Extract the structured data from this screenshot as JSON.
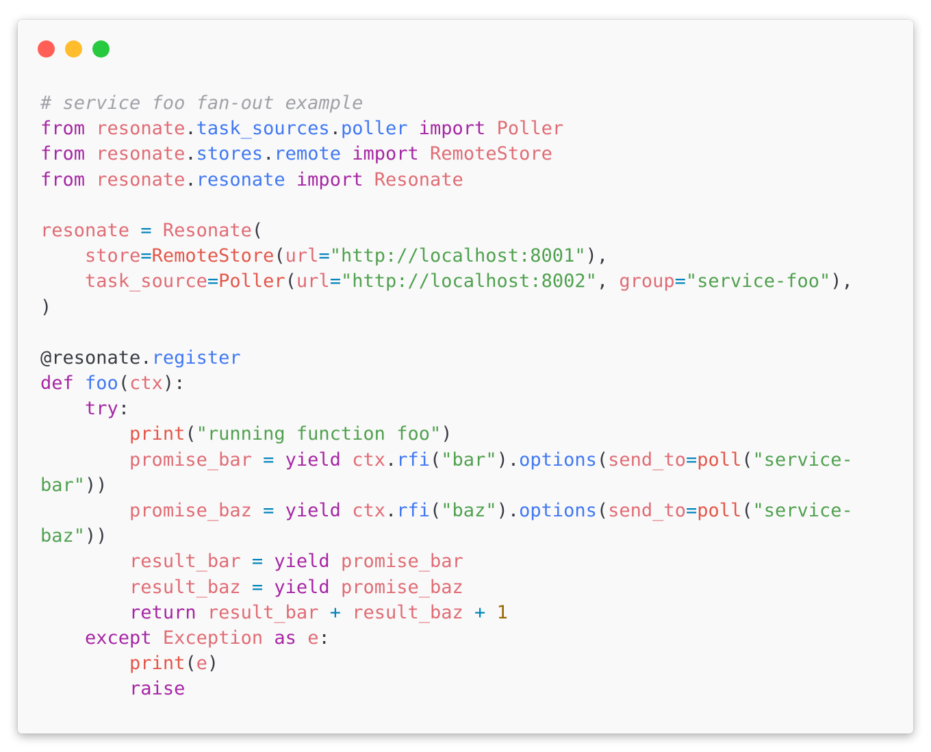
{
  "window": {
    "controls": [
      {
        "name": "close",
        "color": "#ff5f56"
      },
      {
        "name": "minimize",
        "color": "#ffbd2e"
      },
      {
        "name": "zoom",
        "color": "#27c93f"
      }
    ]
  },
  "colors": {
    "comment": "#a0a1a7",
    "keyword": "#a626a4",
    "variable": "#e45649",
    "module": "#e06c75",
    "attribute": "#4078f2",
    "string": "#50a14f",
    "number": "#986801",
    "operator": "#0184bc",
    "plain": "#383a42"
  },
  "code_lines": [
    [
      {
        "t": "# service foo fan-out example",
        "c": "comment",
        "i": true
      }
    ],
    [
      {
        "t": "from",
        "c": "keyword"
      },
      {
        "t": " "
      },
      {
        "t": "resonate",
        "c": "module"
      },
      {
        "t": "."
      },
      {
        "t": "task_sources",
        "c": "attribute"
      },
      {
        "t": "."
      },
      {
        "t": "poller",
        "c": "attribute"
      },
      {
        "t": " "
      },
      {
        "t": "import",
        "c": "keyword"
      },
      {
        "t": " "
      },
      {
        "t": "Poller",
        "c": "module"
      }
    ],
    [
      {
        "t": "from",
        "c": "keyword"
      },
      {
        "t": " "
      },
      {
        "t": "resonate",
        "c": "module"
      },
      {
        "t": "."
      },
      {
        "t": "stores",
        "c": "attribute"
      },
      {
        "t": "."
      },
      {
        "t": "remote",
        "c": "attribute"
      },
      {
        "t": " "
      },
      {
        "t": "import",
        "c": "keyword"
      },
      {
        "t": " "
      },
      {
        "t": "RemoteStore",
        "c": "module"
      }
    ],
    [
      {
        "t": "from",
        "c": "keyword"
      },
      {
        "t": " "
      },
      {
        "t": "resonate",
        "c": "module"
      },
      {
        "t": "."
      },
      {
        "t": "resonate",
        "c": "attribute"
      },
      {
        "t": " "
      },
      {
        "t": "import",
        "c": "keyword"
      },
      {
        "t": " "
      },
      {
        "t": "Resonate",
        "c": "module"
      }
    ],
    [],
    [
      {
        "t": "resonate",
        "c": "module"
      },
      {
        "t": " "
      },
      {
        "t": "=",
        "c": "operator"
      },
      {
        "t": " "
      },
      {
        "t": "Resonate",
        "c": "module"
      },
      {
        "t": "("
      }
    ],
    [
      {
        "t": "    "
      },
      {
        "t": "store",
        "c": "module"
      },
      {
        "t": "=",
        "c": "operator"
      },
      {
        "t": "RemoteStore",
        "c": "variable"
      },
      {
        "t": "("
      },
      {
        "t": "url",
        "c": "module"
      },
      {
        "t": "=",
        "c": "operator"
      },
      {
        "t": "\"http://localhost:8001\"",
        "c": "string"
      },
      {
        "t": "),"
      }
    ],
    [
      {
        "t": "    "
      },
      {
        "t": "task_source",
        "c": "module"
      },
      {
        "t": "=",
        "c": "operator"
      },
      {
        "t": "Poller",
        "c": "variable"
      },
      {
        "t": "("
      },
      {
        "t": "url",
        "c": "module"
      },
      {
        "t": "=",
        "c": "operator"
      },
      {
        "t": "\"http://localhost:8002\"",
        "c": "string"
      },
      {
        "t": ", "
      },
      {
        "t": "group",
        "c": "module"
      },
      {
        "t": "=",
        "c": "operator"
      },
      {
        "t": "\"service-foo\"",
        "c": "string"
      },
      {
        "t": "),"
      }
    ],
    [
      {
        "t": ")"
      }
    ],
    [],
    [
      {
        "t": "@resonate."
      },
      {
        "t": "register",
        "c": "attribute"
      }
    ],
    [
      {
        "t": "def",
        "c": "keyword"
      },
      {
        "t": " "
      },
      {
        "t": "foo",
        "c": "attribute"
      },
      {
        "t": "("
      },
      {
        "t": "ctx",
        "c": "module"
      },
      {
        "t": "):"
      }
    ],
    [
      {
        "t": "    "
      },
      {
        "t": "try",
        "c": "keyword"
      },
      {
        "t": ":"
      }
    ],
    [
      {
        "t": "        "
      },
      {
        "t": "print",
        "c": "variable"
      },
      {
        "t": "("
      },
      {
        "t": "\"running function foo\"",
        "c": "string"
      },
      {
        "t": ")"
      }
    ],
    [
      {
        "t": "        "
      },
      {
        "t": "promise_bar",
        "c": "module"
      },
      {
        "t": " "
      },
      {
        "t": "=",
        "c": "operator"
      },
      {
        "t": " "
      },
      {
        "t": "yield",
        "c": "keyword"
      },
      {
        "t": " "
      },
      {
        "t": "ctx",
        "c": "module"
      },
      {
        "t": "."
      },
      {
        "t": "rfi",
        "c": "attribute"
      },
      {
        "t": "("
      },
      {
        "t": "\"bar\"",
        "c": "string"
      },
      {
        "t": ")."
      },
      {
        "t": "options",
        "c": "attribute"
      },
      {
        "t": "("
      },
      {
        "t": "send_to",
        "c": "module"
      },
      {
        "t": "=",
        "c": "operator"
      },
      {
        "t": "poll",
        "c": "variable"
      },
      {
        "t": "("
      },
      {
        "t": "\"service-",
        "c": "string"
      }
    ],
    [
      {
        "t": "bar\"",
        "c": "string"
      },
      {
        "t": "))"
      }
    ],
    [
      {
        "t": "        "
      },
      {
        "t": "promise_baz",
        "c": "module"
      },
      {
        "t": " "
      },
      {
        "t": "=",
        "c": "operator"
      },
      {
        "t": " "
      },
      {
        "t": "yield",
        "c": "keyword"
      },
      {
        "t": " "
      },
      {
        "t": "ctx",
        "c": "module"
      },
      {
        "t": "."
      },
      {
        "t": "rfi",
        "c": "attribute"
      },
      {
        "t": "("
      },
      {
        "t": "\"baz\"",
        "c": "string"
      },
      {
        "t": ")."
      },
      {
        "t": "options",
        "c": "attribute"
      },
      {
        "t": "("
      },
      {
        "t": "send_to",
        "c": "module"
      },
      {
        "t": "=",
        "c": "operator"
      },
      {
        "t": "poll",
        "c": "variable"
      },
      {
        "t": "("
      },
      {
        "t": "\"service-",
        "c": "string"
      }
    ],
    [
      {
        "t": "baz\"",
        "c": "string"
      },
      {
        "t": "))"
      }
    ],
    [
      {
        "t": "        "
      },
      {
        "t": "result_bar",
        "c": "module"
      },
      {
        "t": " "
      },
      {
        "t": "=",
        "c": "operator"
      },
      {
        "t": " "
      },
      {
        "t": "yield",
        "c": "keyword"
      },
      {
        "t": " "
      },
      {
        "t": "promise_bar",
        "c": "module"
      }
    ],
    [
      {
        "t": "        "
      },
      {
        "t": "result_baz",
        "c": "module"
      },
      {
        "t": " "
      },
      {
        "t": "=",
        "c": "operator"
      },
      {
        "t": " "
      },
      {
        "t": "yield",
        "c": "keyword"
      },
      {
        "t": " "
      },
      {
        "t": "promise_baz",
        "c": "module"
      }
    ],
    [
      {
        "t": "        "
      },
      {
        "t": "return",
        "c": "keyword"
      },
      {
        "t": " "
      },
      {
        "t": "result_bar",
        "c": "module"
      },
      {
        "t": " "
      },
      {
        "t": "+",
        "c": "operator"
      },
      {
        "t": " "
      },
      {
        "t": "result_baz",
        "c": "module"
      },
      {
        "t": " "
      },
      {
        "t": "+",
        "c": "operator"
      },
      {
        "t": " "
      },
      {
        "t": "1",
        "c": "number"
      }
    ],
    [
      {
        "t": "    "
      },
      {
        "t": "except",
        "c": "keyword"
      },
      {
        "t": " "
      },
      {
        "t": "Exception",
        "c": "module"
      },
      {
        "t": " "
      },
      {
        "t": "as",
        "c": "keyword"
      },
      {
        "t": " "
      },
      {
        "t": "e",
        "c": "module"
      },
      {
        "t": ":"
      }
    ],
    [
      {
        "t": "        "
      },
      {
        "t": "print",
        "c": "variable"
      },
      {
        "t": "("
      },
      {
        "t": "e",
        "c": "module"
      },
      {
        "t": ")"
      }
    ],
    [
      {
        "t": "        "
      },
      {
        "t": "raise",
        "c": "keyword"
      }
    ]
  ]
}
